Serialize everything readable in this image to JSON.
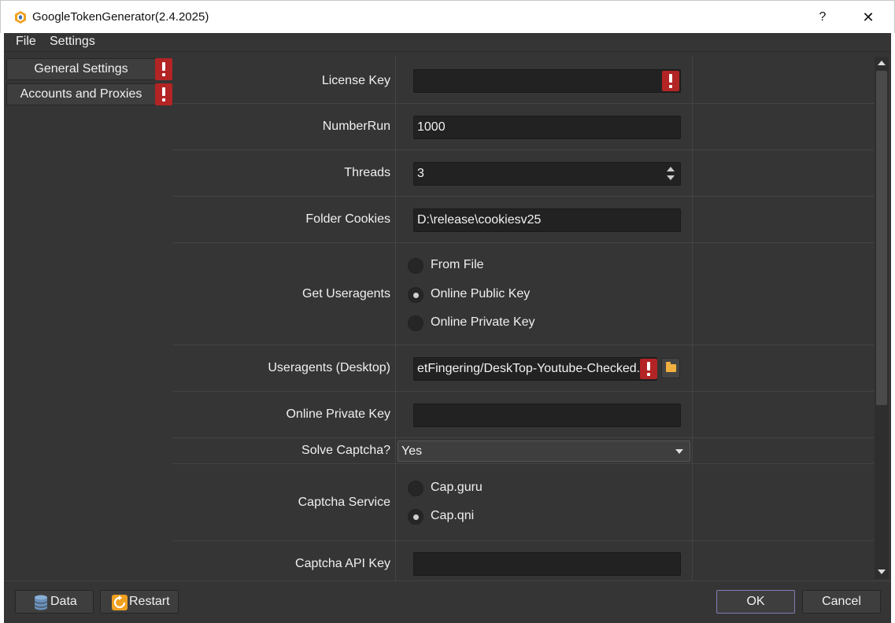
{
  "titlebar": {
    "title": "GoogleTokenGenerator(2.4.2025)",
    "help": "?",
    "close": "✕"
  },
  "menu": {
    "file": "File",
    "settings": "Settings"
  },
  "nav": {
    "general": "General Settings",
    "accounts": "Accounts and Proxies"
  },
  "form": {
    "license_key": {
      "label": "License Key",
      "value": ""
    },
    "number_run": {
      "label": "NumberRun",
      "value": "1000"
    },
    "threads": {
      "label": "Threads",
      "value": "3"
    },
    "folder_cookies": {
      "label": "Folder Cookies",
      "value": "D:\\release\\cookiesv25"
    },
    "get_useragents": {
      "label": "Get Useragents",
      "options": [
        "From File",
        "Online Public Key",
        "Online Private Key"
      ],
      "selected": "Online Public Key"
    },
    "useragents_desktop": {
      "label": "Useragents (Desktop)",
      "value": "etFingering/DeskTop-Youtube-Checked.t"
    },
    "online_private_key": {
      "label": "Online Private Key",
      "value": ""
    },
    "solve_captcha": {
      "label": "Solve Captcha?",
      "value": "Yes"
    },
    "captcha_service": {
      "label": "Captcha Service",
      "options": [
        "Cap.guru",
        "Cap.qni"
      ],
      "selected": "Cap.qni"
    },
    "captcha_api_key": {
      "label": "Captcha API Key",
      "value": ""
    }
  },
  "buttons": {
    "data": "Data",
    "restart": "Restart",
    "ok": "OK",
    "cancel": "Cancel"
  },
  "colors": {
    "background": "#353535",
    "field": "#222222",
    "warning": "#b32424",
    "ok_border": "#8a7ab5"
  }
}
